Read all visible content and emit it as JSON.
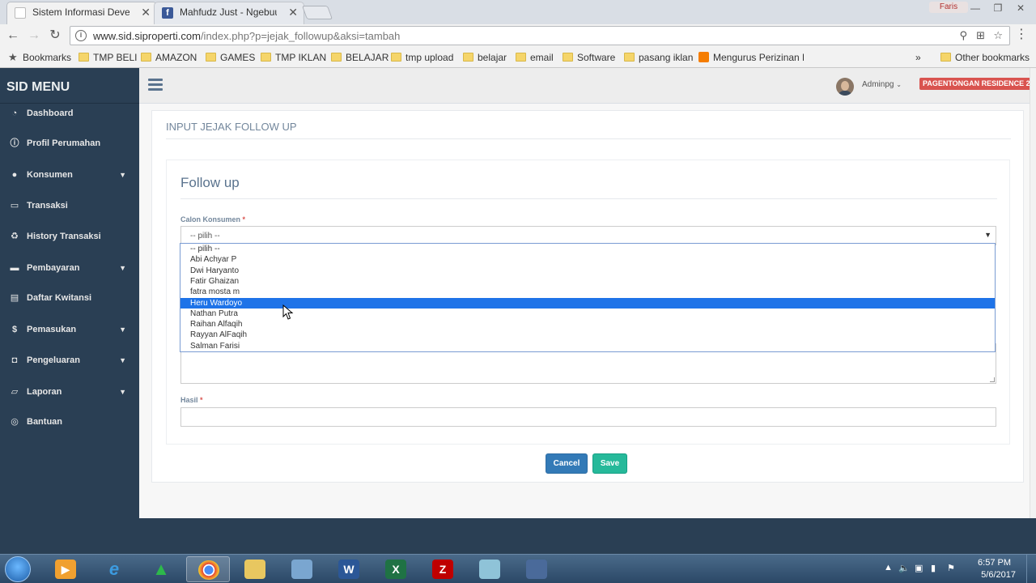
{
  "browser": {
    "tabs": [
      {
        "label": "Sistem Informasi Develop"
      },
      {
        "label": "Mahfudz Just - Ngebuut"
      }
    ],
    "profile_badge": "Faris",
    "url_host": "www.sid.siproperti.com",
    "url_path": "/index.php?p=jejak_followup&aksi=tambah",
    "bookmarks_label": "Bookmarks",
    "bookmarks": [
      "TMP BELI",
      "AMAZON",
      "GAMES",
      "TMP IKLAN",
      "BELAJAR",
      "tmp upload",
      "belajar",
      "email",
      "Software",
      "pasang iklan",
      "Mengurus Perizinan P"
    ],
    "other_bookmarks": "Other bookmarks",
    "overflow": "»"
  },
  "sidebar": {
    "brand": "SID MENU",
    "items": [
      {
        "label": "Dashboard",
        "icon": "dashboard-icon",
        "has_submenu": false
      },
      {
        "label": "Profil Perumahan",
        "icon": "info-icon",
        "has_submenu": false
      },
      {
        "label": "Konsumen",
        "icon": "user-icon",
        "has_submenu": true
      },
      {
        "label": "Transaksi",
        "icon": "cart-icon",
        "has_submenu": false
      },
      {
        "label": "History Transaksi",
        "icon": "recycle-icon",
        "has_submenu": false
      },
      {
        "label": "Pembayaran",
        "icon": "credit-card-icon",
        "has_submenu": true
      },
      {
        "label": "Daftar Kwitansi",
        "icon": "print-icon",
        "has_submenu": false
      },
      {
        "label": "Pemasukan",
        "icon": "dollar-icon",
        "has_submenu": true
      },
      {
        "label": "Pengeluaran",
        "icon": "money-icon",
        "has_submenu": true
      },
      {
        "label": "Laporan",
        "icon": "folder-icon",
        "has_submenu": true
      },
      {
        "label": "Bantuan",
        "icon": "help-icon",
        "has_submenu": false
      }
    ]
  },
  "topnav": {
    "admin_name": "Adminpg",
    "residence_badge": "PAGENTONGAN RESIDENCE 2"
  },
  "page": {
    "panel_title": "INPUT JEJAK FOLLOW UP",
    "card_title": "Follow up",
    "calon_label": "Calon Konsumen",
    "required_mark": "*",
    "select_value": "-- pilih --",
    "hasil_label": "Hasil",
    "options": [
      "-- pilih --",
      "Abi Achyar P",
      "Dwi Haryanto",
      "Fatir Ghaizan",
      "fatra mosta m",
      "Heru Wardoyo",
      "Nathan Putra",
      "Raihan Alfaqih",
      "Rayyan AlFaqih",
      "Salman Farisi"
    ],
    "highlighted_option": "Heru Wardoyo",
    "cancel_label": "Cancel",
    "save_label": "Save"
  },
  "taskbar": {
    "time": "6:57 PM",
    "date": "5/6/2017"
  },
  "colors": {
    "sidebar_bg": "#2a3f54",
    "primary_button": "#337ab7",
    "success_button": "#26b99a",
    "danger_badge": "#d9534f",
    "option_highlight": "#1e73e8"
  }
}
